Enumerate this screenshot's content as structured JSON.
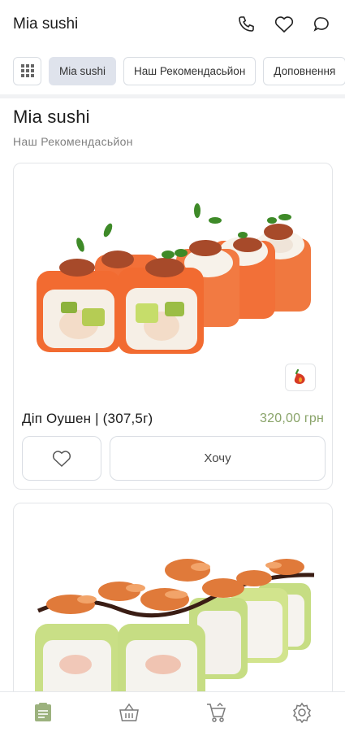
{
  "header": {
    "title": "Mia sushi",
    "icons": [
      "phone-icon",
      "heart-icon",
      "chat-icon"
    ]
  },
  "categories": {
    "grid_icon": "grid-icon",
    "items": [
      {
        "label": "Mia sushi",
        "active": true
      },
      {
        "label": "Наш Рекомендасьйон",
        "active": false
      },
      {
        "label": "Доповнення",
        "active": false
      }
    ]
  },
  "section": {
    "title": "Mia sushi",
    "subtitle": "Наш Рекомендасьйон"
  },
  "products": [
    {
      "name": "Діп Оушен | (307,5г)",
      "price": "320,00 грн",
      "badge_icon": "chili-pepper-icon",
      "want_label": "Хочу"
    },
    {
      "name": "",
      "price": ""
    }
  ],
  "bottom_nav": {
    "items": [
      "menu-icon",
      "basket-icon",
      "cart-icon",
      "settings-icon"
    ],
    "active": "menu-icon"
  },
  "colors": {
    "accent_green": "#8aa46a",
    "chip_active_bg": "#dfe3ec",
    "salmon": "#f2703a",
    "avocado": "#c6dd83"
  }
}
